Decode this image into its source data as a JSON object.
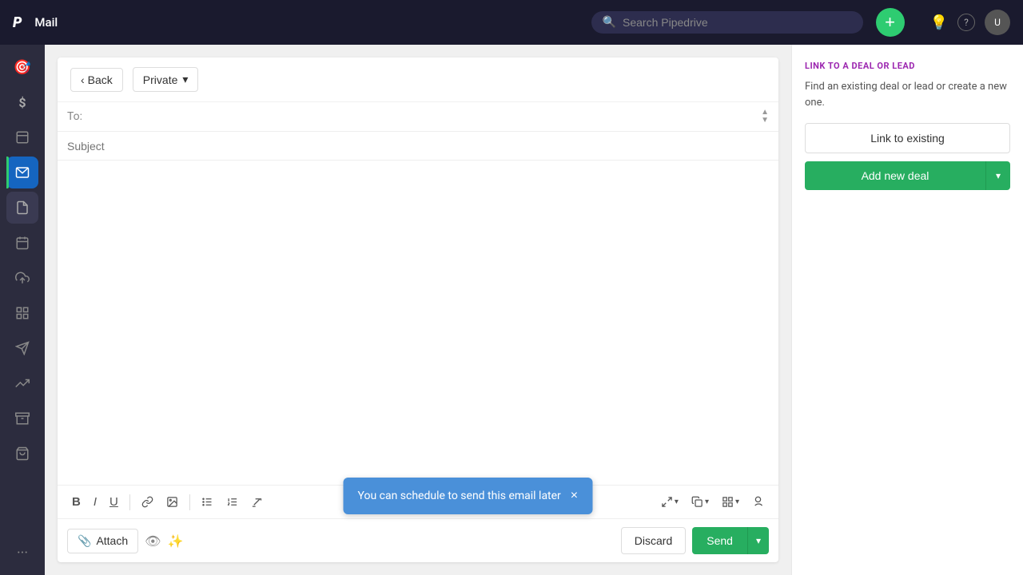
{
  "app": {
    "logo": "P",
    "title": "Mail"
  },
  "search": {
    "placeholder": "Search Pipedrive"
  },
  "nav": {
    "add_button": "+",
    "light_icon": "💡",
    "help_icon": "?",
    "avatar_initials": "U"
  },
  "sidebar": {
    "items": [
      {
        "id": "target",
        "icon": "🎯",
        "active": false
      },
      {
        "id": "dollar",
        "icon": "$",
        "active": false
      },
      {
        "id": "image",
        "icon": "🖼",
        "active": false
      },
      {
        "id": "mail",
        "icon": "✉",
        "active": true,
        "mail_active": true,
        "has_indicator": true
      },
      {
        "id": "docs",
        "icon": "📄",
        "active": false
      },
      {
        "id": "calendar",
        "icon": "📅",
        "active": false
      },
      {
        "id": "upload",
        "icon": "📤",
        "active": false
      },
      {
        "id": "chart",
        "icon": "📊",
        "active": false
      },
      {
        "id": "arrow",
        "icon": "➤",
        "active": false
      },
      {
        "id": "trend",
        "icon": "📈",
        "active": false
      },
      {
        "id": "box",
        "icon": "🗃",
        "active": false
      },
      {
        "id": "grid",
        "icon": "⊞",
        "active": false
      }
    ],
    "more_label": "···"
  },
  "composer": {
    "back_label": "Back",
    "privacy_label": "Private",
    "to_label": "To:",
    "to_placeholder": "",
    "subject_placeholder": "Subject",
    "body_text": "",
    "toolbar": {
      "bold": "B",
      "italic": "I",
      "underline": "U",
      "link": "🔗",
      "image": "🖼",
      "bullet_list": "≡",
      "ordered_list": "≣",
      "clear": "Tx",
      "expand1": "⤢",
      "expand2": "⧉",
      "expand3": "⊞",
      "sign": "✍"
    },
    "attach_label": "Attach",
    "discard_label": "Discard",
    "send_label": "Send"
  },
  "tooltip": {
    "message": "You can schedule to send this email later",
    "close_icon": "×"
  },
  "right_panel": {
    "section_title": "LINK TO A DEAL OR LEAD",
    "description": "Find an existing deal or lead or create a new one.",
    "link_existing_label": "Link to existing",
    "add_deal_label": "Add new deal"
  }
}
